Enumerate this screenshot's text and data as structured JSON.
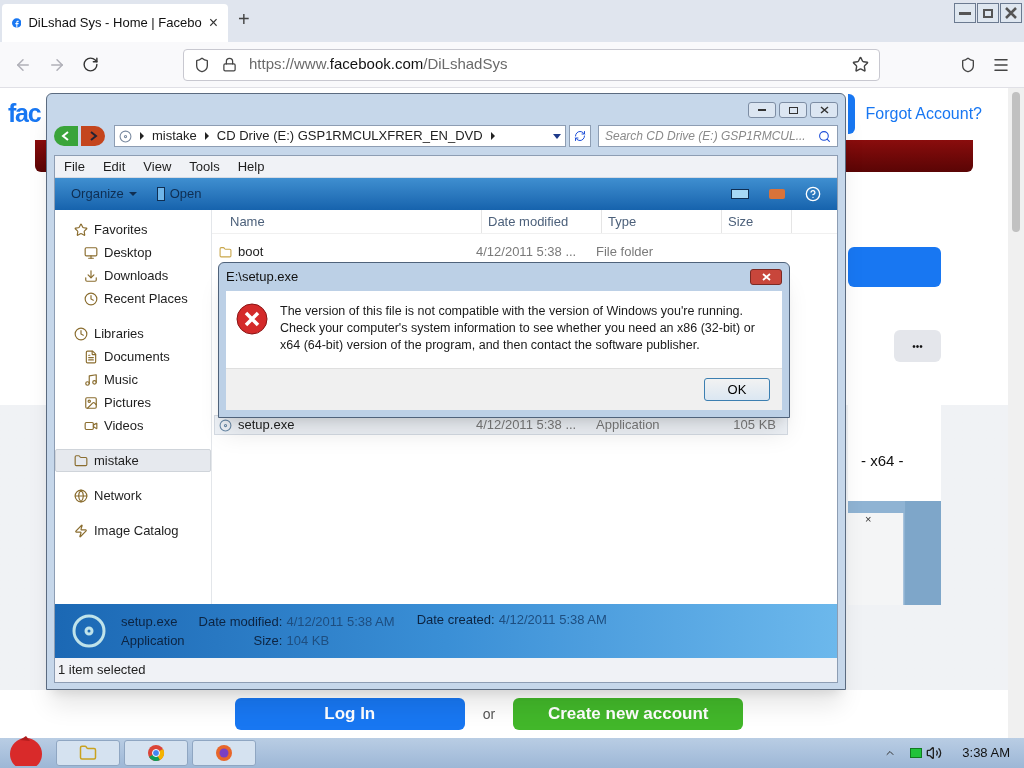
{
  "browser": {
    "tab_title": "DiLshad Sys - Home | Facebo",
    "tab_close": "×",
    "new_tab": "+",
    "url": {
      "prefix": "https://www.",
      "domain": "facebook.com",
      "path": "/DiLshadSys"
    }
  },
  "facebook": {
    "logo": "fac",
    "forgot_link": "Forgot Account?",
    "more_button": "•••",
    "card_text": "- x64 -",
    "card_close": "×",
    "login_button": "Log In",
    "or": "or",
    "create_button": "Create new account"
  },
  "explorer": {
    "breadcrumb": [
      "mistake",
      "CD Drive (E:) GSP1RMCULXFRER_EN_DVD"
    ],
    "search_placeholder": "Search CD Drive (E:) GSP1RMCUL...",
    "menu": [
      "File",
      "Edit",
      "View",
      "Tools",
      "Help"
    ],
    "commands": [
      "Organize",
      "Open"
    ],
    "nav": [
      {
        "label": "Favorites",
        "selected": false,
        "children": [
          {
            "label": "Desktop",
            "selected": false
          },
          {
            "label": "Downloads",
            "selected": false
          },
          {
            "label": "Recent Places",
            "selected": false
          }
        ]
      },
      {
        "label": "Libraries",
        "selected": false,
        "children": [
          {
            "label": "Documents",
            "selected": false
          },
          {
            "label": "Music",
            "selected": false
          },
          {
            "label": "Pictures",
            "selected": false
          },
          {
            "label": "Videos",
            "selected": false
          }
        ]
      },
      {
        "label": "mistake",
        "selected": true
      },
      {
        "label": "Network",
        "selected": false
      },
      {
        "label": "Image Catalog",
        "selected": false
      }
    ],
    "columns": [
      "Name",
      "Date modified",
      "Type",
      "Size"
    ],
    "files": [
      {
        "kind": "folder",
        "name": "boot",
        "date": "4/12/2011 5:38 ...",
        "type": "File folder",
        "selected": false
      },
      {
        "kind": "app",
        "name": "setup.exe",
        "date": "4/12/2011 5:38 ...",
        "type": "Application",
        "size": "105 KB",
        "selected": true
      }
    ],
    "details": {
      "name": "setup.exe",
      "type": "Application",
      "modified_label": "Date modified:",
      "modified": "4/12/2011 5:38 AM",
      "created_label": "Date created:",
      "created": "4/12/2011 5:38 AM",
      "size_label": "Size:",
      "size": "104 KB"
    },
    "status": "1 item selected"
  },
  "dialog": {
    "title": "E:\\setup.exe",
    "message": "The version of this file is not compatible with the version of Windows you're running. Check your computer's system information to see whether you need an x86 (32-bit) or x64 (64-bit) version of the program, and then contact the software publisher.",
    "ok": "OK"
  },
  "taskbar": {
    "apps": [
      {
        "kind": "explorer"
      },
      {
        "kind": "chrome"
      },
      {
        "kind": "firefox"
      }
    ],
    "clock": "3:38 AM"
  }
}
